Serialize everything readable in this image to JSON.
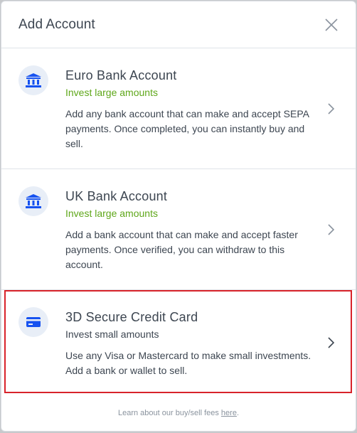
{
  "dialog": {
    "title": "Add Account",
    "close_icon": "close-icon"
  },
  "options": [
    {
      "icon": "bank-icon",
      "title": "Euro Bank Account",
      "subtitle": "Invest large amounts",
      "description": "Add any bank account that can make and accept SEPA payments. Once completed, you can instantly buy and sell."
    },
    {
      "icon": "bank-icon",
      "title": "UK Bank Account",
      "subtitle": "Invest large amounts",
      "description": "Add a bank account that can make and accept faster payments. Once verified, you can withdraw to this account."
    },
    {
      "icon": "credit-card-icon",
      "title": "3D Secure Credit Card",
      "subtitle": "Invest small amounts",
      "description": "Use any Visa or Mastercard to make small investments. Add a bank or wallet to sell."
    }
  ],
  "footer": {
    "text": "Learn about our buy/sell fees ",
    "link": "here",
    "suffix": "."
  },
  "colors": {
    "accent": "#1652f0",
    "green": "#5fa71a",
    "highlight": "#d8232a"
  }
}
